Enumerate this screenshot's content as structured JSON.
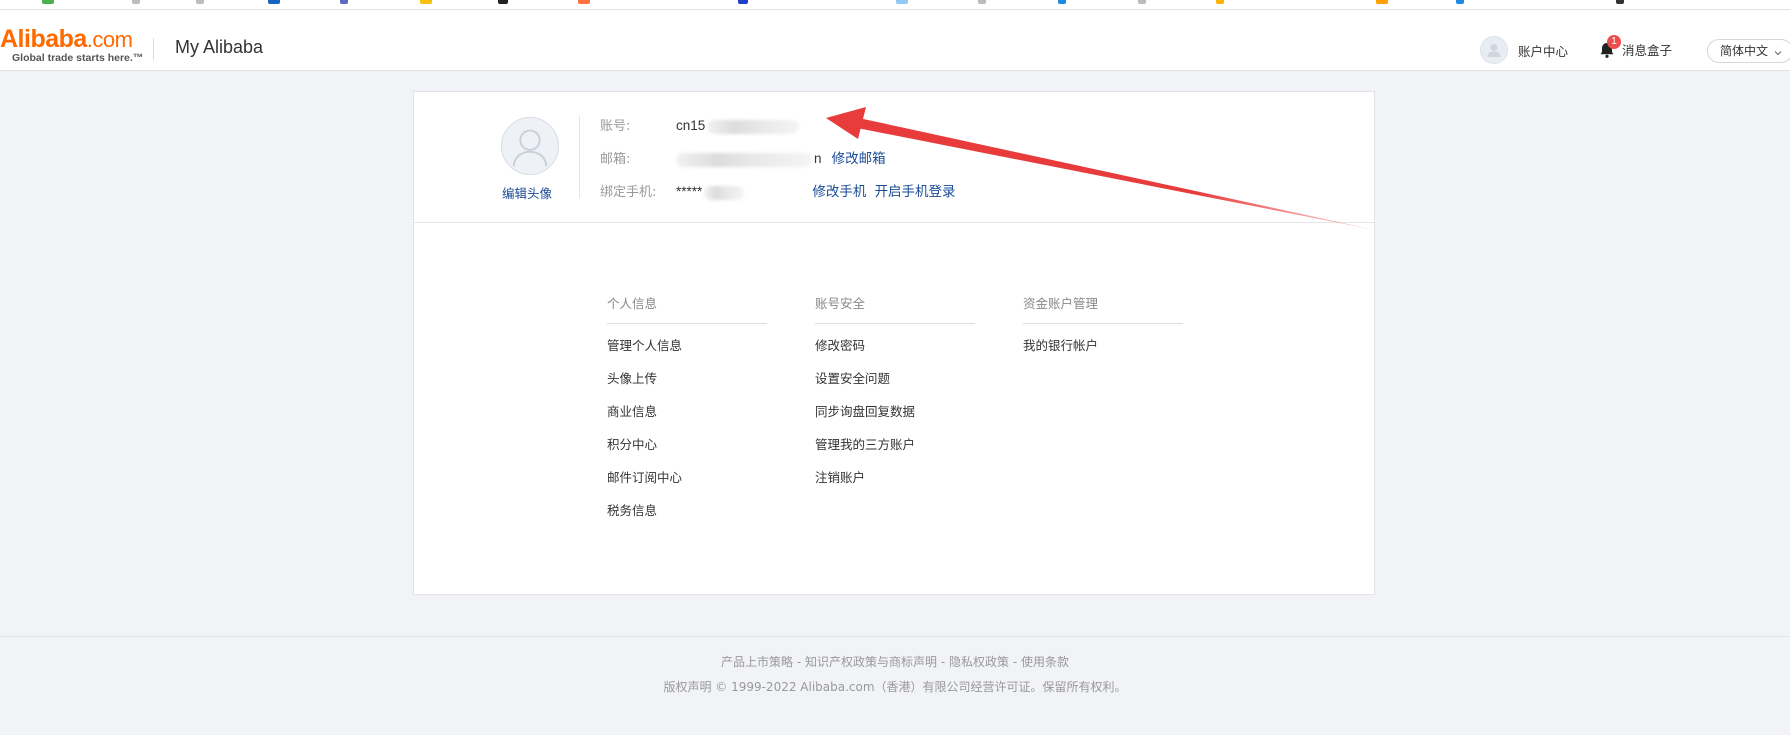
{
  "header": {
    "logo_main": "Alibaba",
    "logo_suffix": ".com",
    "logo_tagline": "Global trade starts here.™",
    "title": "My Alibaba",
    "account_center": "账户中心",
    "messages_label": "消息盒子",
    "messages_count": "1",
    "language": "简体中文"
  },
  "profile": {
    "edit_avatar": "编辑头像",
    "account_label": "账号:",
    "account_value": "cn15",
    "email_label": "邮箱:",
    "email_tail": "n",
    "change_email": "修改邮箱",
    "phone_label": "绑定手机:",
    "phone_value": "*****",
    "change_phone": "修改手机",
    "enable_phone_login": "开启手机登录"
  },
  "sections": [
    {
      "title": "个人信息",
      "items": [
        "管理个人信息",
        "头像上传",
        "商业信息",
        "积分中心",
        "邮件订阅中心",
        "税务信息"
      ]
    },
    {
      "title": "账号安全",
      "items": [
        "修改密码",
        "设置安全问题",
        "同步询盘回复数据",
        "管理我的三方账户",
        "注销账户"
      ]
    },
    {
      "title": "资金账户管理",
      "items": [
        "我的银行帐户"
      ]
    }
  ],
  "footer": {
    "links": [
      "产品上市策略",
      "知识产权政策与商标声明",
      "隐私权政策",
      "使用条款"
    ],
    "separator": " - ",
    "copyright": "版权声明 © 1999-2022 Alibaba.com（香港）有限公司经营许可证。保留所有权利。"
  },
  "colors": {
    "brand": "#ff6a00",
    "link": "#1a4b96",
    "annotation_arrow": "#e83b3b",
    "badge": "#ee4d4d"
  }
}
